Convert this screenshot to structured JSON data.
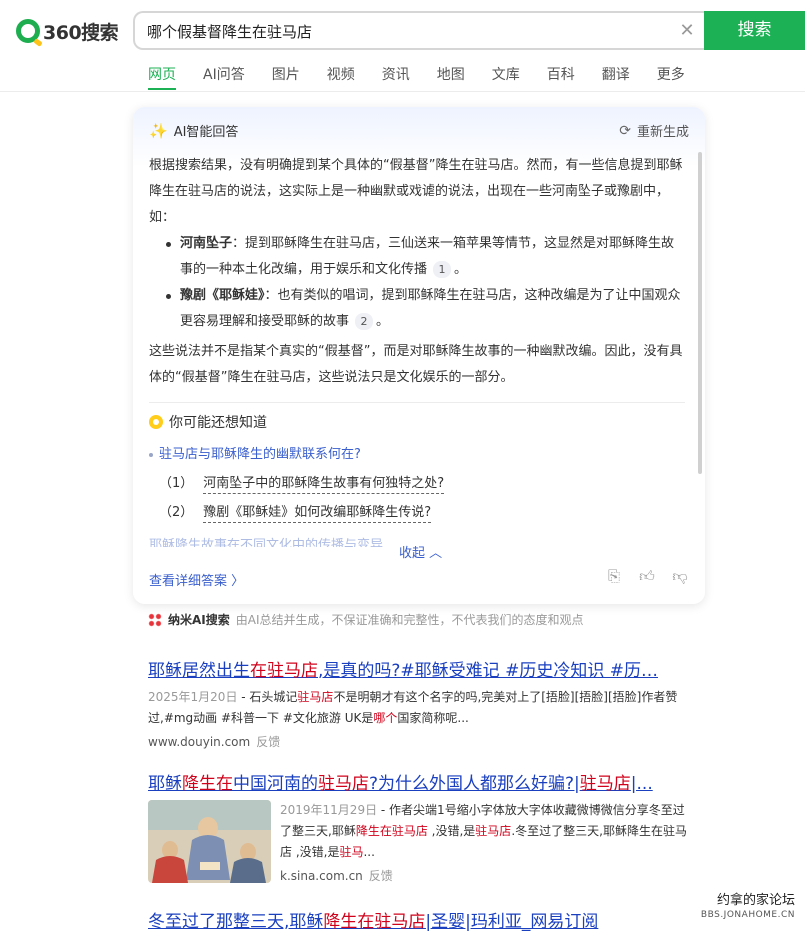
{
  "header": {
    "logo_text": "360搜索",
    "search_value": "哪个假基督降生在驻马店",
    "search_button": "搜索",
    "clear_icon": "close-icon"
  },
  "nav": {
    "items": [
      "网页",
      "AI问答",
      "图片",
      "视频",
      "资讯",
      "地图",
      "文库",
      "百科",
      "翻译",
      "更多"
    ],
    "active": "网页"
  },
  "ai_card": {
    "title": "AI智能回答",
    "regenerate": "重新生成",
    "intro": "根据搜索结果，没有明确提到某个具体的“假基督”降生在驻马店。然而，有一些信息提到耶稣降生在驻马店的说法，这实际上是一种幽默或戏谑的说法，出现在一些河南坠子或豫剧中，如：",
    "bullets": [
      {
        "term": "河南坠子",
        "text": "：提到耶稣降生在驻马店，三仙送来一箱苹果等情节，这显然是对耶稣降生故事的一种本土化改编，用于娱乐和文化传播",
        "cite": "1",
        "end": "。"
      },
      {
        "term": "豫剧《耶稣娃》",
        "text": "：也有类似的唱词，提到耶稣降生在驻马店，这种改编是为了让中国观众更容易理解和接受耶稣的故事",
        "cite": "2",
        "end": "。"
      }
    ],
    "conclusion": "这些说法并不是指某个真实的“假基督”，而是对耶稣降生故事的一种幽默改编。因此，没有具体的“假基督”降生在驻马店，这些说法只是文化娱乐的一部分。",
    "know_title": "你可能还想知道",
    "related_question": "驻马店与耶稣降生的幽默联系何在?",
    "sub_questions": [
      {
        "num": "（1）",
        "text": "河南坠子中的耶稣降生故事有何独特之处?"
      },
      {
        "num": "（2）",
        "text": "豫剧《耶稣娃》如何改编耶稣降生传说?"
      }
    ],
    "faded_text": "耶稣降生故事在不同文化中的传播与变异",
    "collapse": "收起 ︿",
    "detail_link": "查看详细答案 〉"
  },
  "source_line": {
    "name": "纳米AI搜索",
    "note": "由AI总结并生成，不保证准确和完整性，不代表我们的态度和观点"
  },
  "results": [
    {
      "title_parts": [
        {
          "t": "耶稣居然出生",
          "hl": false
        },
        {
          "t": "在驻马店",
          "hl": true
        },
        {
          "t": ",是真的吗?#耶稣受难记 #历史冷知识 #历…",
          "hl": false
        }
      ],
      "date": "2025年1月20日",
      "desc_parts": [
        {
          "t": " - 石头城记",
          "hl": false
        },
        {
          "t": "驻马店",
          "hl": true
        },
        {
          "t": "不是明朝才有这个名字的吗,完美对上了[捂脸][捂脸][捂脸]作者赞过,#mg动画 #科普一下 #文化旅游 UK是",
          "hl": false
        },
        {
          "t": "哪个",
          "hl": true
        },
        {
          "t": "国家简称呢...",
          "hl": false
        }
      ],
      "url": "www.douyin.com",
      "feedback": "反馈"
    },
    {
      "title_parts": [
        {
          "t": "耶稣",
          "hl": false
        },
        {
          "t": "降生在",
          "hl": true
        },
        {
          "t": "中国河南的",
          "hl": false
        },
        {
          "t": "驻马店",
          "hl": true
        },
        {
          "t": "?为什么外国人都那么好骗?|",
          "hl": false
        },
        {
          "t": "驻马店",
          "hl": true
        },
        {
          "t": "|...",
          "hl": false
        }
      ],
      "date": "2019年11月29日",
      "desc_parts": [
        {
          "t": " - 作者尖端1号缩小字体放大字体收藏微博微信分享冬至过了整三天,耶稣",
          "hl": false
        },
        {
          "t": "降生在驻马店",
          "hl": true
        },
        {
          "t": " ,没错,是",
          "hl": false
        },
        {
          "t": "驻马店",
          "hl": true
        },
        {
          "t": ".冬至过了整三天,耶稣降生在驻马店 ,没错,是",
          "hl": false
        },
        {
          "t": "驻马",
          "hl": true
        },
        {
          "t": "...",
          "hl": false
        }
      ],
      "url": "k.sina.com.cn",
      "feedback": "反馈"
    },
    {
      "title_parts": [
        {
          "t": "冬至过了那整三天,耶稣",
          "hl": false
        },
        {
          "t": "降生在驻马店",
          "hl": true
        },
        {
          "t": "|圣婴|玛利亚_网易订阅",
          "hl": false
        }
      ]
    }
  ],
  "watermark": {
    "line1": "约拿的家论坛",
    "line2": "BBS.JONAHOME.CN"
  },
  "colors": {
    "brand_green": "#1db155",
    "link_blue": "#1a3fbf",
    "highlight_red": "#d0021b"
  }
}
